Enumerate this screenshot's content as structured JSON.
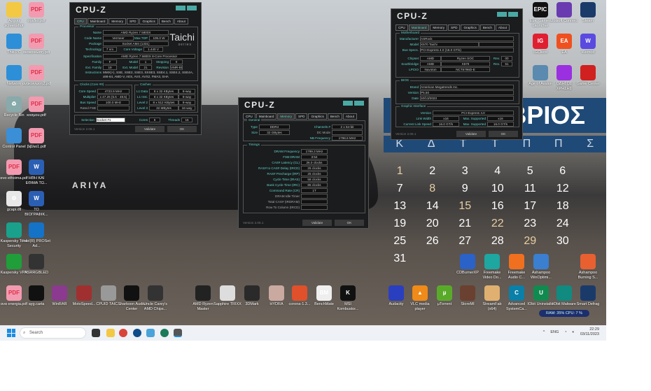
{
  "desktop": {
    "car_brand": "ARIYA"
  },
  "calendar": {
    "month_fragment": "ΒΡΙΟΣ",
    "weekdays": [
      "Κ",
      "Δ",
      "Τ",
      "Τ",
      "Π",
      "Π",
      "Σ"
    ],
    "days": [
      "1",
      "2",
      "3",
      "4",
      "5",
      "6",
      "7",
      "8",
      "9",
      "10",
      "11",
      "12",
      "13",
      "14",
      "15",
      "16",
      "17",
      "18",
      "19",
      "20",
      "21",
      "22",
      "23",
      "24",
      "25",
      "26",
      "27",
      "28",
      "29",
      "30",
      "31"
    ]
  },
  "icons": [
    {
      "label": "Αρχεία screenshot",
      "glyph": "",
      "color": "#f3c843"
    },
    {
      "label": "This PC",
      "glyph": "",
      "color": "#2d8fd8"
    },
    {
      "label": "Network",
      "glyph": "",
      "color": "#2d8fd8"
    },
    {
      "label": "Recycle Bin",
      "glyph": "♻",
      "color": "#8aa"
    },
    {
      "label": "Control Panel",
      "glyph": "",
      "color": "#3b8fd6"
    },
    {
      "label": "ανα ethoima.pdf",
      "glyph": "PDF",
      "color": "#f29bb0"
    },
    {
      "label": "gcapi.dll",
      "glyph": "⚙",
      "color": "#e8e8e8"
    },
    {
      "label": "Kaspersky Total Security",
      "glyph": "",
      "color": "#1aa18b"
    },
    {
      "label": "Kaspersky VPN",
      "glyph": "",
      "color": "#1f9e3a"
    },
    {
      "label": "ανα energia.pdf",
      "glyph": "PDF",
      "color": "#f29bb0"
    },
    {
      "label": "σχεδιο.pdf",
      "glyph": "PDF",
      "color": "#f29bb0"
    },
    {
      "label": "ανακοινωση.pdf",
      "glyph": "PDF",
      "color": "#f29bb0"
    },
    {
      "label": "ανακοινωση2.pdf",
      "glyph": "PDF",
      "color": "#f29bb0"
    },
    {
      "label": "κοσμου.pdf",
      "glyph": "PDF",
      "color": "#f29bb0"
    },
    {
      "label": "βιβλιο1.pdf",
      "glyph": "PDF",
      "color": "#f29bb0"
    },
    {
      "label": "ΗΘΗ ΚΑΙ ΕΘΙΜΑ ΤΩ...",
      "glyph": "W",
      "color": "#2b5fb4"
    },
    {
      "label": "ΤΟ ΒΙΟΓΡΑΦΙΚ...",
      "glyph": "W",
      "color": "#2b5fb4"
    },
    {
      "label": "Intel(R) PROSet Ad...",
      "glyph": "",
      "color": "#1473c7"
    },
    {
      "label": "ASRRGBLED",
      "glyph": "",
      "color": "#333"
    },
    {
      "label": "ayg.carta",
      "glyph": "",
      "color": "#111"
    },
    {
      "label": "WinRAR",
      "glyph": "",
      "color": "#8b3a8f"
    },
    {
      "label": "MotoSpeed...",
      "glyph": "",
      "color": "#a03030"
    },
    {
      "label": "CPUID TAIC...",
      "glyph": "",
      "color": "#999"
    },
    {
      "label": "Sharkoon Audio Center",
      "glyph": "",
      "color": "#111"
    },
    {
      "label": "Uncle Carey's AMD Chips...",
      "glyph": "",
      "color": "#333"
    },
    {
      "label": "AMD Ryzen Master",
      "glyph": "",
      "color": "#222"
    },
    {
      "label": "Sapphire TRIXX",
      "glyph": "",
      "color": "#ddd"
    },
    {
      "label": "3DMark",
      "glyph": "",
      "color": "#2a2a2a"
    },
    {
      "label": "HYDRA",
      "glyph": "",
      "color": "#c9a9a0"
    },
    {
      "label": "corona-1.3...",
      "glyph": "",
      "color": "#e0502a"
    },
    {
      "label": "BenchMate",
      "glyph": "BM",
      "color": "#eee"
    },
    {
      "label": "MSI Kombustor...",
      "glyph": "K",
      "color": "#111"
    },
    {
      "label": "CDBurnerXP",
      "glyph": "",
      "color": "#2a62c8"
    },
    {
      "label": "Freemake Video Do...",
      "glyph": "",
      "color": "#1ea6a0"
    },
    {
      "label": "Freemake Audio C...",
      "glyph": "",
      "color": "#f07020"
    },
    {
      "label": "Ashampoo WinOptimi...",
      "glyph": "",
      "color": "#3a7fd0"
    },
    {
      "label": "Ashampoo Burning S...",
      "glyph": "",
      "color": "#e86030"
    },
    {
      "label": "Audacity",
      "glyph": "",
      "color": "#2a3fbf"
    },
    {
      "label": "VLC media player",
      "glyph": "▲",
      "color": "#f08a18"
    },
    {
      "label": "µTorrent",
      "glyph": "µ",
      "color": "#5aaa2a"
    },
    {
      "label": "StoreMI",
      "glyph": "",
      "color": "#6a4030"
    },
    {
      "label": "StreamFab (x64)",
      "glyph": "",
      "color": "#e0b070"
    },
    {
      "label": "Advanced SystemCa...",
      "glyph": "C",
      "color": "#0a7fa8"
    },
    {
      "label": "IObit Uninstaller",
      "glyph": "U",
      "color": "#118a50"
    },
    {
      "label": "IObit Malware",
      "glyph": "",
      "color": "#118a80"
    },
    {
      "label": "Smart Defrag",
      "glyph": "",
      "color": "#1a3a6a"
    },
    {
      "label": "Epic Games Launcher",
      "glyph": "EPIC",
      "color": "#111"
    },
    {
      "label": "Ubisoft Connect",
      "glyph": "",
      "color": "#6a3ab0"
    },
    {
      "label": "Steam",
      "glyph": "",
      "color": "#1a3a6a"
    },
    {
      "label": "IGClient",
      "glyph": "IG",
      "color": "#e02030"
    },
    {
      "label": "EA",
      "glyph": "EA",
      "color": "#f05020"
    },
    {
      "label": "Wemod",
      "glyph": "W",
      "color": "#5a4ae0"
    },
    {
      "label": "Age of Avalon",
      "glyph": "",
      "color": "#5a8ab0"
    },
    {
      "label": "ΟΔΗΓΟΣ ΧΡΗΣΗΣ",
      "glyph": "",
      "color": "#9a30e0"
    },
    {
      "label": "Game Center",
      "glyph": "",
      "color": "#d02020"
    }
  ],
  "cpuz_cpu": {
    "title": "CPU-Z",
    "tabs": [
      "CPU",
      "Mainboard",
      "Memory",
      "SPD",
      "Graphics",
      "Bench",
      "About"
    ],
    "active_tab": "CPU",
    "processor_label": "Processor",
    "logo": "Taichi",
    "logo_sub": "series",
    "name_l": "Name",
    "name": "AMD Ryzen 7 5800X",
    "codename_l": "Code Name",
    "codename": "Vermeer",
    "maxtdp_l": "Max TDP",
    "maxtdp": "105.0 W",
    "package_l": "Package",
    "package": "Socket AM4 (1331)",
    "tech_l": "Technology",
    "tech": "7 nm",
    "cv_l": "Core Voltage",
    "cv": "1.440 V",
    "spec_l": "Specification",
    "spec": "AMD Ryzen 7 5800X 8-Core Processor",
    "family_l": "Family",
    "family": "F",
    "model_l": "Model",
    "model": "1",
    "stepping_l": "Stepping",
    "stepping": "0",
    "extfam_l": "Ext. Family",
    "extfam": "19",
    "extmodel_l": "Ext. Model",
    "extmodel": "21",
    "rev_l": "Revision",
    "rev": "VMR-B0",
    "instr_l": "Instructions",
    "instr": "MMX(+), SSE, SSE2, SSE3, SSSE3, SSE4.1, SSE4.2, SSE4A, x86-64, AMD-V, AES, AVX, AVX2, FMA3, SHA",
    "clocks_label": "Clocks (Core #0)",
    "caches_label": "Caches",
    "cs_l": "Core Speed",
    "cs": "4723.9 MHz",
    "mult_l": "Multiplier",
    "mult": "x 47.25 (5.5 - 48.5)",
    "bus_l": "Bus Speed",
    "bus": "100.0 MHz",
    "fsb_l": "Rated FSB",
    "fsb": "",
    "l1d_l": "L1 Data",
    "l1d": "8 x 32 KBytes",
    "l1d_w": "8-way",
    "l1i_l": "L1 Inst.",
    "l1i": "8 x 32 KBytes",
    "l1i_w": "8-way",
    "l2_l": "Level 2",
    "l2": "8 x 512 KBytes",
    "l2_w": "8-way",
    "l3_l": "Level 3",
    "l3": "32 MBytes",
    "l3_w": "16-way",
    "sel_l": "Selection",
    "sel": "Socket #1",
    "cores_l": "Cores",
    "cores": "8",
    "threads_l": "Threads",
    "threads": "16",
    "version": "Version 2.06.1",
    "validate": "Validate",
    "ok": "OK"
  },
  "cpuz_mem": {
    "title": "CPU-Z",
    "tabs": [
      "CPU",
      "Mainboard",
      "Memory",
      "SPD",
      "Graphics",
      "Bench",
      "About"
    ],
    "active_tab": "Memory",
    "general_label": "General",
    "type_l": "Type",
    "type": "DDR4",
    "size_l": "Size",
    "size": "32 GBytes",
    "ch_l": "Channels #",
    "ch": "2 x 64-bit",
    "dc_l": "DC Mode",
    "dc": "",
    "nb_l": "NB Frequency",
    "nb": "1798.6 MHz",
    "timings_label": "Timings",
    "timings": [
      [
        "DRAM Frequency",
        "1799.3 MHz"
      ],
      [
        "FSB:DRAM",
        "3:54"
      ],
      [
        "CAS# Latency (CL)",
        "26.0 clocks"
      ],
      [
        "RAS# to CAS# Delay (tRCD)",
        "25 clocks"
      ],
      [
        "RAS# Precharge (tRP)",
        "25 clocks"
      ],
      [
        "Cycle Time (tRAS)",
        "58 clocks"
      ],
      [
        "Bank Cycle Time (tRC)",
        "85 clocks"
      ],
      [
        "Command Rate (CR)",
        "1T"
      ],
      [
        "DRAM Idle Timer",
        ""
      ],
      [
        "Total CAS# (tRDRAM)",
        ""
      ],
      [
        "Row To Column (tRCD)",
        ""
      ]
    ],
    "version": "Version 2.06.1",
    "validate": "Validate",
    "ok": "OK"
  },
  "cpuz_mb": {
    "title": "CPU-Z",
    "tabs": [
      "CPU",
      "Mainboard",
      "Memory",
      "SPD",
      "Graphics",
      "Bench",
      "About"
    ],
    "active_tab": "Mainboard",
    "mb_label": "Motherboard",
    "man_l": "Manufacturer",
    "man": "ASRock",
    "model_l": "Model",
    "model": "X570 Taichi",
    "bus_l": "Bus Specs.",
    "bus": "PCI-Express 4.0 (16.0 GT/s)",
    "chip_l": "Chipset",
    "chip_v": "AMD",
    "chip_m": "Ryzen SOC",
    "chip_rev_l": "Rev.",
    "chip_rev": "00",
    "sb_l": "Southbridge",
    "sb_v": "AMD",
    "sb_m": "X570",
    "sb_rev_l": "Rev.",
    "sb_rev": "51",
    "lpc_l": "LPCIO",
    "lpc_v": "Nuvoton",
    "lpc_m": "NCT6796D-E",
    "bios_label": "BIOS",
    "brand_l": "Brand",
    "brand": "American Megatrends Inc.",
    "ver_l": "Version",
    "ver": "P5.50",
    "date_l": "Date",
    "date": "10/13/2023",
    "gi_label": "Graphic Interface",
    "giv_l": "Version",
    "giv": "PCI-Express 4.0",
    "lw_l": "Link Width",
    "lw": "x16",
    "lw_max_l": "Max. Supported",
    "lw_max": "x16",
    "ls_l": "Current Link Speed",
    "ls": "16.0 GT/s",
    "ls_max_l": "Max. Supported",
    "ls_max": "16.0 GT/s",
    "version": "Version 2.06.1",
    "validate": "Validate",
    "ok": "OK"
  },
  "taskbar": {
    "search_placeholder": "Search",
    "tray_lang": "ENG",
    "time": "22:29",
    "date": "03/11/2023",
    "perf": "RAM: 35%  CPU: 7 %"
  }
}
